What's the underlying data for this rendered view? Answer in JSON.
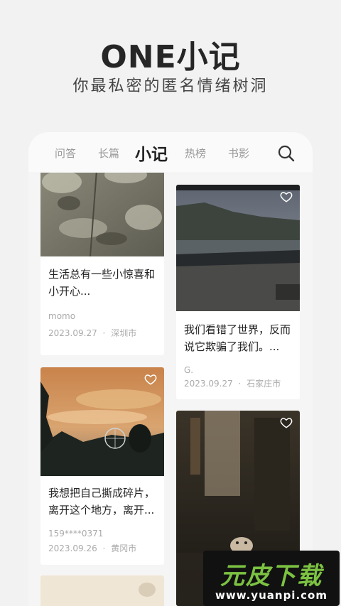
{
  "hero": {
    "title": "ONE小记",
    "subtitle": "你最私密的匿名情绪树洞"
  },
  "tabs": [
    {
      "label": "问答",
      "active": false
    },
    {
      "label": "长篇",
      "active": false
    },
    {
      "label": "小记",
      "active": true
    },
    {
      "label": "热榜",
      "active": false
    },
    {
      "label": "书影",
      "active": false
    }
  ],
  "search_icon": "search-icon",
  "cards": [
    {
      "text": "生活总有一些小惊喜和小开心...",
      "author": "momo",
      "date": "2023.09.27",
      "location": "深圳市"
    },
    {
      "text": "我们看错了世界，反而说它欺骗了我们。...",
      "author": "G.",
      "date": "2023.09.27",
      "location": "石家庄市"
    },
    {
      "text": "我想把自己撕成碎片，离开这个地方，离开...",
      "author": "159****0371",
      "date": "2023.09.26",
      "location": "黄冈市"
    },
    {
      "text": "",
      "author": "",
      "date": "",
      "location": ""
    }
  ],
  "meta_separator": "·",
  "watermark": {
    "main": "元皮下载",
    "url": "www.yuanpi.com"
  },
  "colors": {
    "background": "#f2f2f2",
    "card": "#ffffff",
    "text_primary": "#222222",
    "text_muted": "#aaaaaa",
    "watermark_green": "#7cc242"
  }
}
